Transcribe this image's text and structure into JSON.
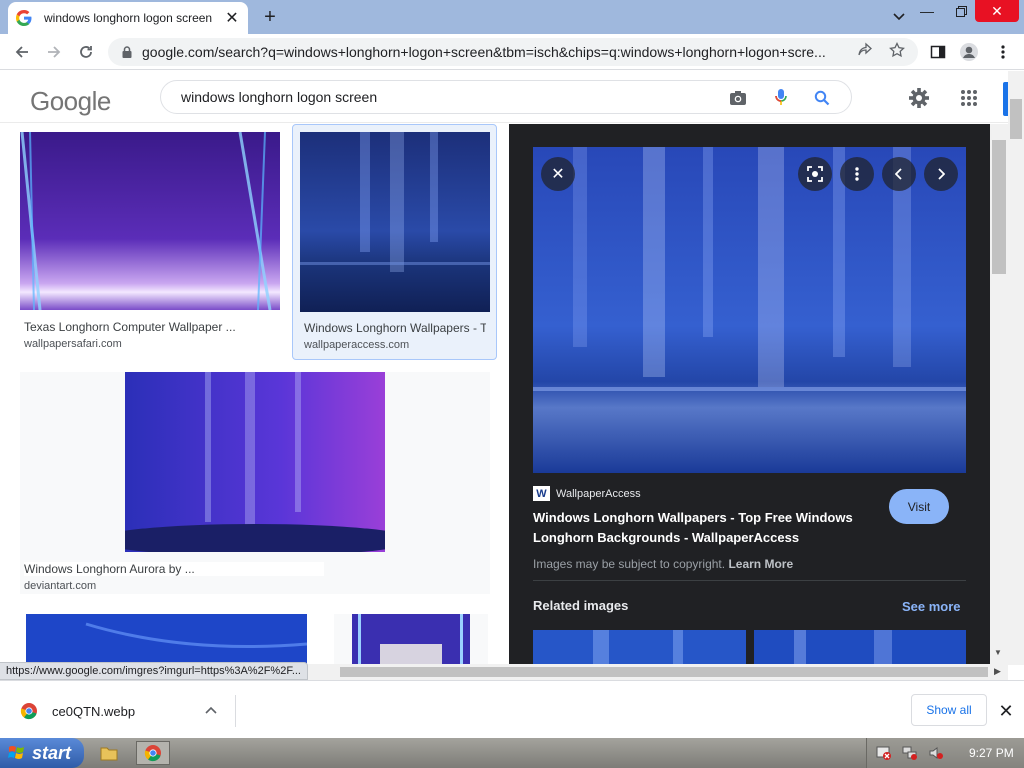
{
  "browser": {
    "tab_title": "windows longhorn logon screen",
    "url": "google.com/search?q=windows+longhorn+logon+screen&tbm=isch&chips=q:windows+longhorn+logon+scre...",
    "status_url": "https://www.google.com/imgres?imgurl=https%3A%2F%2F..."
  },
  "google": {
    "logo": "Google",
    "query": "windows longhorn logon screen"
  },
  "results": [
    {
      "title": "Texas Longhorn Computer Wallpaper ...",
      "site": "wallpapersafari.com"
    },
    {
      "title": "Windows Longhorn Wallpapers - Top Free ...",
      "site": "wallpaperaccess.com"
    },
    {
      "title": "Windows Longhorn Aurora by ...",
      "site": "deviantart.com"
    }
  ],
  "preview": {
    "source_logo": "W",
    "source_name": "WallpaperAccess",
    "title": "Windows Longhorn Wallpapers - Top Free Windows Longhorn Backgrounds - WallpaperAccess",
    "visit_label": "Visit",
    "copyright_text": "Images may be subject to copyright.",
    "learn_more": "Learn More",
    "related_label": "Related images",
    "see_more": "See more"
  },
  "downloads": {
    "file_name": "ce0QTN.webp",
    "show_all": "Show all"
  },
  "taskbar": {
    "start_label": "start",
    "clock": "9:27 PM"
  },
  "colors": {
    "accent": "#1a73e8",
    "tabstrip": "#9fb8dd",
    "preview_bg": "#202124",
    "visit_button": "#8ab4f8"
  }
}
